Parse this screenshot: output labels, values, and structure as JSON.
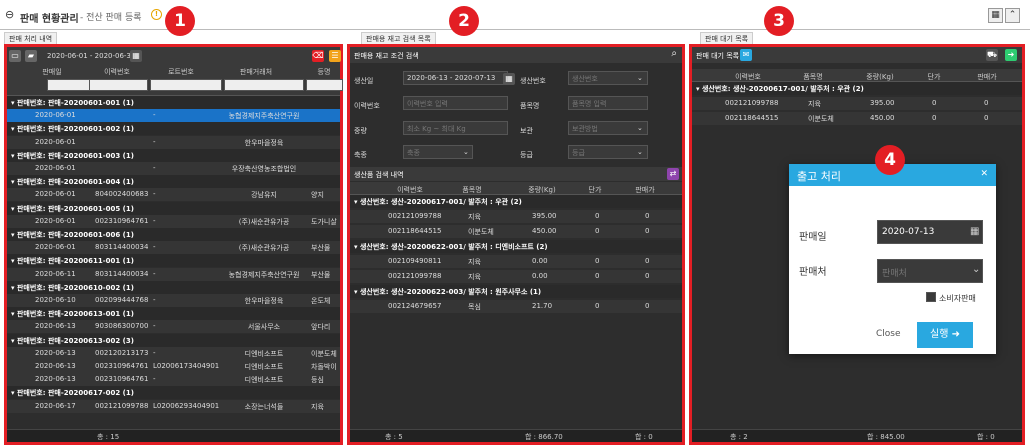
{
  "header": {
    "title": "판매 현황관리",
    "subtitle": "- 전산 판매 등록"
  },
  "sections": {
    "s1": "판매 처리 내역",
    "s2": "판매용 재고 검색 목록",
    "s3": "판매 대기 목록"
  },
  "badges": [
    "1",
    "2",
    "3",
    "4"
  ],
  "left": {
    "date_range": "2020-06-01 - 2020-06-30",
    "columns": [
      "판매일",
      "이력번호",
      "로트번호",
      "판매거래처",
      "등명"
    ],
    "rows": [
      {
        "g": "판매번호: 판매-20200601-001 (1)"
      },
      {
        "d": "2020-06-01",
        "t": "",
        "l": "-",
        "c": "농협경제지주축산연구원",
        "e": "",
        "sel": true
      },
      {
        "g": "판매번호: 판매-20200601-002 (1)"
      },
      {
        "d": "2020-06-01",
        "t": "",
        "l": "-",
        "c": "한우마을정육",
        "e": ""
      },
      {
        "g": "판매번호: 판매-20200601-003 (1)"
      },
      {
        "d": "2020-06-01",
        "t": "",
        "l": "-",
        "c": "우장축산영농조합법인",
        "e": ""
      },
      {
        "g": "판매번호: 판매-20200601-004 (1)"
      },
      {
        "d": "2020-06-01",
        "t": "804002400683",
        "l": "-",
        "c": "강남유지",
        "e": "양지"
      },
      {
        "g": "판매번호: 판매-20200601-005 (1)"
      },
      {
        "d": "2020-06-01",
        "t": "002310964761",
        "l": "-",
        "c": "(주)새순관유가공",
        "e": "도가니살"
      },
      {
        "g": "판매번호: 판매-20200601-006 (1)"
      },
      {
        "d": "2020-06-01",
        "t": "803114400034",
        "l": "-",
        "c": "(주)새순관유가공",
        "e": "부산물"
      },
      {
        "g": "판매번호: 판매-20200611-001 (1)"
      },
      {
        "d": "2020-06-11",
        "t": "803114400034",
        "l": "-",
        "c": "농협경제지주축산연구원",
        "e": "부산물"
      },
      {
        "g": "판매번호: 판매-20200610-002 (1)"
      },
      {
        "d": "2020-06-10",
        "t": "002099444768",
        "l": "-",
        "c": "한우마을정육",
        "e": "온도체"
      },
      {
        "g": "판매번호: 판매-20200613-001 (1)"
      },
      {
        "d": "2020-06-13",
        "t": "903086300700",
        "l": "-",
        "c": "서울사무소",
        "e": "앞다리"
      },
      {
        "g": "판매번호: 판매-20200613-002 (3)"
      },
      {
        "d": "2020-06-13",
        "t": "002120213173",
        "l": "-",
        "c": "디엔비소프트",
        "e": "이분도체"
      },
      {
        "d": "2020-06-13",
        "t": "002310964761",
        "l": "L02006173404901",
        "c": "디엔비소프트",
        "e": "차돌박이"
      },
      {
        "d": "2020-06-13",
        "t": "002310964761",
        "l": "-",
        "c": "디엔비소프트",
        "e": "등심"
      },
      {
        "g": "판매번호: 판매-20200617-002 (1)"
      },
      {
        "d": "2020-06-17",
        "t": "002121099788",
        "l": "L02006293404901",
        "c": "소장는너석들",
        "e": "지육"
      }
    ],
    "total": "총 : 15"
  },
  "mid": {
    "title": "판매용 재고 조건 검색",
    "f": {
      "date_l": "생산일",
      "date_v": "2020-06-13 - 2020-07-13",
      "prod_l": "생산번호",
      "prod_p": "생산번호",
      "trace_l": "이력번호",
      "trace_p": "이력번호 입력",
      "item_l": "품목명",
      "item_p": "품목명 입력",
      "w_l": "중량",
      "w_min": "최소",
      "w_max": "최대",
      "kg": "Kg",
      "wave": "~",
      "store_l": "보관",
      "store_p": "보관방법",
      "kind_l": "축종",
      "kind_p": "축종",
      "grade_l": "등급",
      "grade_p": "등급"
    },
    "sub": "생산품 검색 내역",
    "columns": [
      "이력번호",
      "품목명",
      "중량(Kg)",
      "단가",
      "판매가"
    ],
    "rows": [
      {
        "g": "생산번호: 생산-20200617-001/ 발주처 : 우관 (2)"
      },
      {
        "a": "002121099788",
        "b": "지육",
        "c": "395.00",
        "d": "0",
        "e": "0"
      },
      {
        "a": "002118644515",
        "b": "이분도체",
        "c": "450.00",
        "d": "0",
        "e": "0"
      },
      {
        "g": "생산번호: 생산-20200622-001/ 발주처 : 디엔비소프트 (2)"
      },
      {
        "a": "002109490811",
        "b": "지육",
        "c": "0.00",
        "d": "0",
        "e": "0"
      },
      {
        "a": "002121099788",
        "b": "지육",
        "c": "0.00",
        "d": "0",
        "e": "0"
      },
      {
        "g": "생산번호: 생산-20200622-003/ 발주처 : 원주사무소 (1)"
      },
      {
        "a": "002124679657",
        "b": "목심",
        "c": "21.70",
        "d": "0",
        "e": "0"
      }
    ],
    "foot": [
      "총 : 5",
      "합 : 866.70",
      "합 : 0"
    ]
  },
  "right": {
    "title": "판매 대기 목록",
    "columns": [
      "이력번호",
      "품목명",
      "중량(Kg)",
      "단가",
      "판매가"
    ],
    "rows": [
      {
        "g": "생산번호: 생산-20200617-001/ 발주처 : 우관 (2)"
      },
      {
        "a": "002121099788",
        "b": "지육",
        "c": "395.00",
        "d": "0",
        "e": "0"
      },
      {
        "a": "002118644515",
        "b": "이분도체",
        "c": "450.00",
        "d": "0",
        "e": "0"
      }
    ],
    "foot": [
      "총 : 2",
      "합 : 845.00",
      "합 : 0"
    ]
  },
  "modal": {
    "title": "출고 처리",
    "date_l": "판매일",
    "date_v": "2020-07-13",
    "buyer_l": "판매처",
    "buyer_p": "판매처",
    "consumer": "소비자판매",
    "close": "Close",
    "run": "실행"
  },
  "colors": {
    "accent": "#e31e24",
    "blue": "#29a8e0"
  }
}
